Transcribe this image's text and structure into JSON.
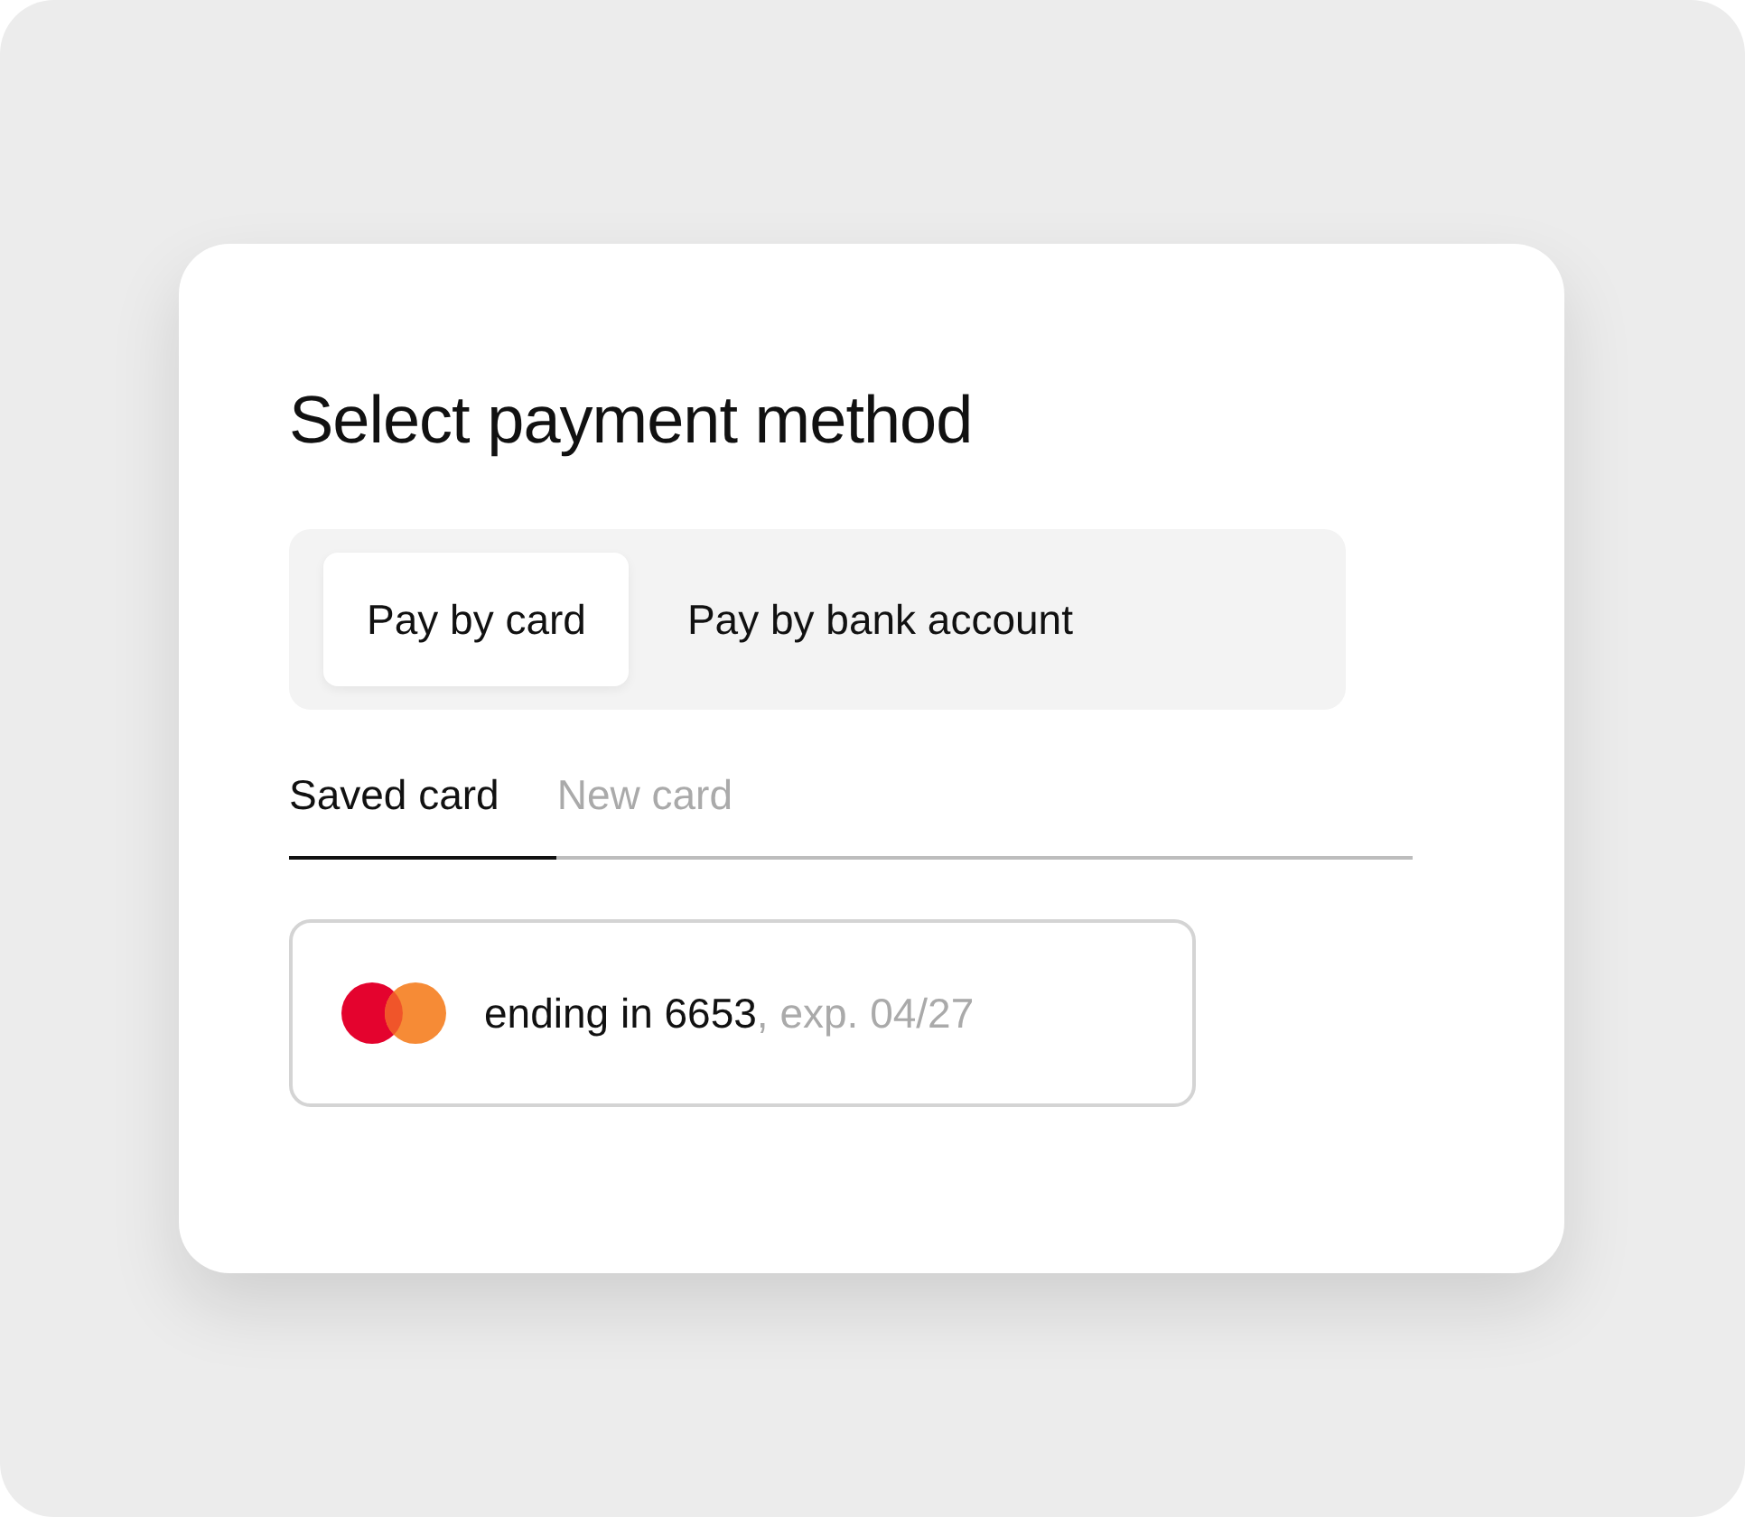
{
  "title": "Select payment method",
  "methods": [
    {
      "label": "Pay by card",
      "selected": true
    },
    {
      "label": "Pay by bank account",
      "selected": false
    }
  ],
  "tabs": [
    {
      "label": "Saved card",
      "selected": true
    },
    {
      "label": "New card",
      "selected": false
    }
  ],
  "saved_card": {
    "label": "ending in 6653",
    "expiry": ", exp. 04/27"
  }
}
